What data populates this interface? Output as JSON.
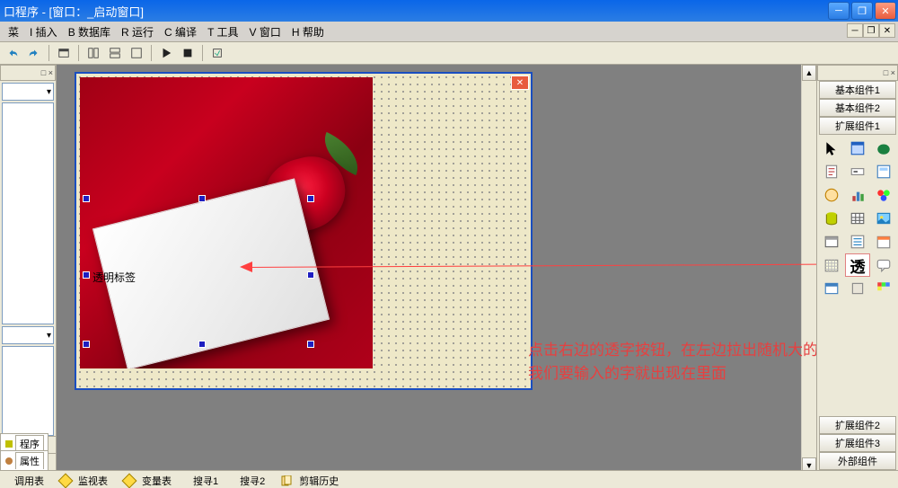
{
  "titlebar": {
    "title": "口程序 - [窗口：_启动窗口]"
  },
  "menu": {
    "items": [
      "菜",
      "I 插入",
      "B 数据库",
      "R 运行",
      "C 编译",
      "T 工具",
      "V 窗口",
      "H 帮助"
    ]
  },
  "left_panel": {
    "tab_program": "程序",
    "tab_property": "属性",
    "hdr_glyph": "□ ×"
  },
  "designer": {
    "label_text": "透明标签"
  },
  "right_panel": {
    "groups": [
      "基本组件1",
      "基本组件2",
      "扩展组件1",
      "扩展组件2",
      "扩展组件3",
      "外部组件"
    ],
    "trans_char": "透"
  },
  "statusbar": {
    "items": [
      "调用表",
      "监视表",
      "变量表",
      "搜寻1",
      "搜寻2",
      "剪辑历史"
    ]
  },
  "annotation": {
    "text": "点击右边的透字按钮，在左边拉出随机大的框，等下我们要输入的字就出现在里面"
  }
}
